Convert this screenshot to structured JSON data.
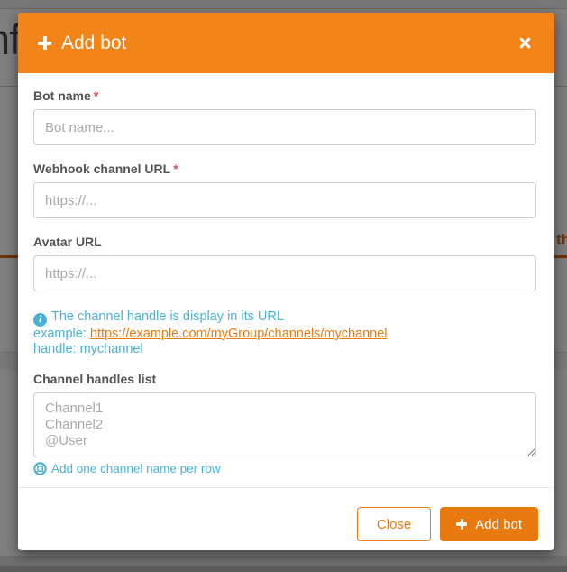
{
  "colors": {
    "header_orange": "#f28418",
    "button_orange": "#e8790f",
    "info_blue": "#48b2d6",
    "link_orange": "#e87c0e",
    "required_red": "#d9534f",
    "tab_orange": "#e0690f"
  },
  "background": {
    "page_title_fragment": "nf",
    "tab_label_fragment": "th"
  },
  "modal": {
    "title": "Add bot",
    "required_mark": "*",
    "icons": [
      "plus-icon",
      "close-icon",
      "info-circle-icon",
      "life-ring-icon"
    ],
    "bot_name": {
      "label": "Bot name",
      "placeholder": "Bot name..."
    },
    "webhook_url": {
      "label": "Webhook channel URL",
      "placeholder": "https://..."
    },
    "avatar_url": {
      "label": "Avatar URL",
      "placeholder": "https://..."
    },
    "info": {
      "line1": "The channel handle is display in its URL",
      "example_prefix": "example: ",
      "example_link": "https://example.com/myGroup/channels/mychannel",
      "handle_line": "handle: mychannel"
    },
    "handles": {
      "label": "Channel handles list",
      "placeholder": "Channel1\nChannel2\n@User",
      "help": "Add one channel name per row"
    },
    "footer": {
      "close_label": "Close",
      "submit_label": "Add bot"
    }
  }
}
